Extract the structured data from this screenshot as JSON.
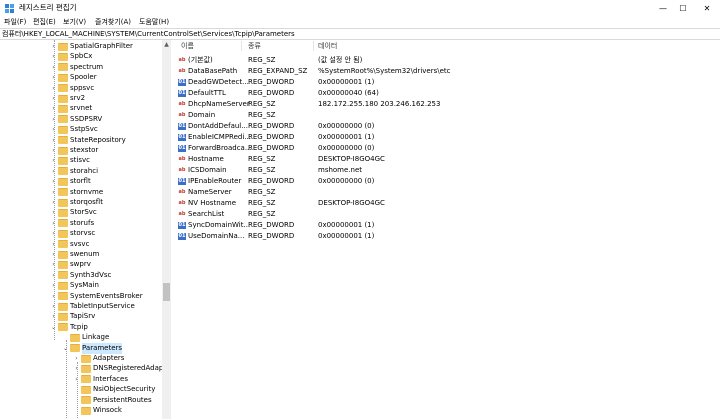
{
  "window": {
    "title": "레지스트리 편집기",
    "minimize": "—",
    "maximize": "☐",
    "close": "✕"
  },
  "menu": [
    "파일(F)",
    "편집(E)",
    "보기(V)",
    "즐겨찾기(A)",
    "도움말(H)"
  ],
  "address": "컴퓨터\\HKEY_LOCAL_MACHINE\\SYSTEM\\CurrentControlSet\\Services\\Tcpip\\Parameters",
  "tree": {
    "items": [
      {
        "label": "SpatialGraphFilter",
        "level": 0,
        "expander": ">"
      },
      {
        "label": "SpbCx",
        "level": 0,
        "expander": ">"
      },
      {
        "label": "spectrum",
        "level": 0,
        "expander": ">"
      },
      {
        "label": "Spooler",
        "level": 0,
        "expander": ">"
      },
      {
        "label": "sppsvc",
        "level": 0,
        "expander": ">"
      },
      {
        "label": "srv2",
        "level": 0,
        "expander": ">"
      },
      {
        "label": "srvnet",
        "level": 0,
        "expander": ">"
      },
      {
        "label": "SSDPSRV",
        "level": 0,
        "expander": ">"
      },
      {
        "label": "SstpSvc",
        "level": 0,
        "expander": ">"
      },
      {
        "label": "StateRepository",
        "level": 0,
        "expander": ">"
      },
      {
        "label": "stexstor",
        "level": 0,
        "expander": ">"
      },
      {
        "label": "stisvc",
        "level": 0,
        "expander": ">"
      },
      {
        "label": "storahci",
        "level": 0,
        "expander": ">"
      },
      {
        "label": "storflt",
        "level": 0,
        "expander": ">"
      },
      {
        "label": "stornvme",
        "level": 0,
        "expander": ">"
      },
      {
        "label": "storqosflt",
        "level": 0,
        "expander": ">"
      },
      {
        "label": "StorSvc",
        "level": 0,
        "expander": ">"
      },
      {
        "label": "storufs",
        "level": 0,
        "expander": ">"
      },
      {
        "label": "storvsc",
        "level": 0,
        "expander": ">"
      },
      {
        "label": "svsvc",
        "level": 0,
        "expander": ">"
      },
      {
        "label": "swenum",
        "level": 0,
        "expander": ">"
      },
      {
        "label": "swprv",
        "level": 0,
        "expander": ">"
      },
      {
        "label": "Synth3dVsc",
        "level": 0,
        "expander": ">"
      },
      {
        "label": "SysMain",
        "level": 0,
        "expander": ">"
      },
      {
        "label": "SystemEventsBroker",
        "level": 0,
        "expander": ">"
      },
      {
        "label": "TabletInputService",
        "level": 0,
        "expander": ">"
      },
      {
        "label": "TapiSrv",
        "level": 0,
        "expander": ">"
      },
      {
        "label": "Tcpip",
        "level": 0,
        "expander": "v"
      },
      {
        "label": "Linkage",
        "level": 1,
        "expander": ""
      },
      {
        "label": "Parameters",
        "level": 1,
        "expander": "v",
        "selected": true
      },
      {
        "label": "Adapters",
        "level": 2,
        "expander": ">"
      },
      {
        "label": "DNSRegisteredAdapters",
        "level": 2,
        "expander": ">"
      },
      {
        "label": "Interfaces",
        "level": 2,
        "expander": ">"
      },
      {
        "label": "NsiObjectSecurity",
        "level": 2,
        "expander": ""
      },
      {
        "label": "PersistentRoutes",
        "level": 2,
        "expander": ""
      },
      {
        "label": "Winsock",
        "level": 2,
        "expander": ""
      }
    ]
  },
  "list": {
    "columns": {
      "name": "이름",
      "type": "종류",
      "data": "데이터"
    },
    "rows": [
      {
        "icon": "ab",
        "name": "(기본값)",
        "type": "REG_SZ",
        "data": "(값 설정 안 됨)"
      },
      {
        "icon": "ab",
        "name": "DataBasePath",
        "type": "REG_EXPAND_SZ",
        "data": "%SystemRoot%\\System32\\drivers\\etc"
      },
      {
        "icon": "bin",
        "name": "DeadGWDetect...",
        "type": "REG_DWORD",
        "data": "0x00000001 (1)"
      },
      {
        "icon": "bin",
        "name": "DefaultTTL",
        "type": "REG_DWORD",
        "data": "0x00000040 (64)"
      },
      {
        "icon": "ab",
        "name": "DhcpNameServer",
        "type": "REG_SZ",
        "data": "182.172.255.180 203.246.162.253"
      },
      {
        "icon": "ab",
        "name": "Domain",
        "type": "REG_SZ",
        "data": ""
      },
      {
        "icon": "bin",
        "name": "DontAddDefaul...",
        "type": "REG_DWORD",
        "data": "0x00000000 (0)"
      },
      {
        "icon": "bin",
        "name": "EnableICMPRedi...",
        "type": "REG_DWORD",
        "data": "0x00000001 (1)"
      },
      {
        "icon": "bin",
        "name": "ForwardBroadca...",
        "type": "REG_DWORD",
        "data": "0x00000000 (0)"
      },
      {
        "icon": "ab",
        "name": "Hostname",
        "type": "REG_SZ",
        "data": "DESKTOP-I8GO4GC"
      },
      {
        "icon": "ab",
        "name": "ICSDomain",
        "type": "REG_SZ",
        "data": "mshome.net"
      },
      {
        "icon": "bin",
        "name": "IPEnableRouter",
        "type": "REG_DWORD",
        "data": "0x00000000 (0)"
      },
      {
        "icon": "ab",
        "name": "NameServer",
        "type": "REG_SZ",
        "data": ""
      },
      {
        "icon": "ab",
        "name": "NV Hostname",
        "type": "REG_SZ",
        "data": "DESKTOP-I8GO4GC"
      },
      {
        "icon": "ab",
        "name": "SearchList",
        "type": "REG_SZ",
        "data": ""
      },
      {
        "icon": "bin",
        "name": "SyncDomainWit...",
        "type": "REG_DWORD",
        "data": "0x00000001 (1)"
      },
      {
        "icon": "bin",
        "name": "UseDomainNa...",
        "type": "REG_DWORD",
        "data": "0x00000001 (1)"
      }
    ]
  }
}
